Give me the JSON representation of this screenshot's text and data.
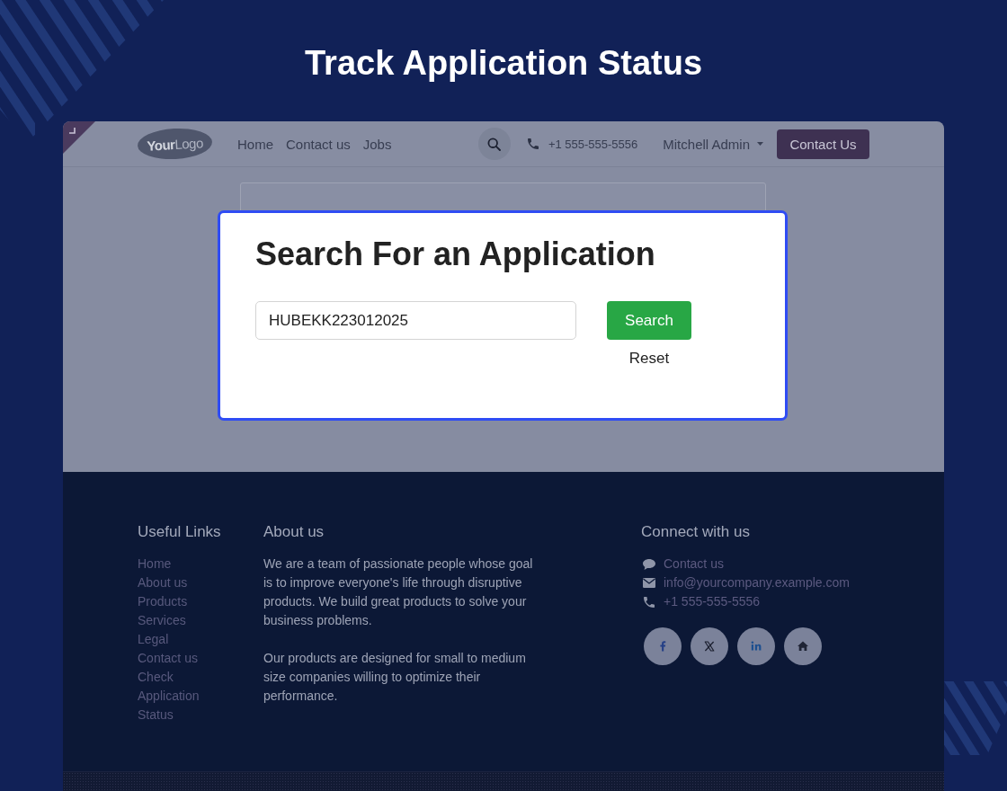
{
  "page_title": "Track Application Status",
  "site": {
    "header": {
      "logo": "**Your**Logo",
      "nav": [
        {
          "label": "Home"
        },
        {
          "label": "Contact us"
        },
        {
          "label": "Jobs"
        }
      ],
      "phone": "+1 555-555-5556",
      "user": "Mitchell Admin",
      "cta": "Contact Us"
    },
    "dialog": {
      "title": "Search For an Application",
      "search_field": {
        "value": "HUBEKK223012025"
      },
      "search_button": "Search",
      "reset": "Reset"
    },
    "footer": {
      "useful_links": {
        "heading": "Useful Links",
        "links": [
          "Home",
          "About us",
          "Products",
          "Services",
          "Legal",
          "Contact us",
          "Check Application Status"
        ]
      },
      "about": {
        "heading": "About us",
        "paragraphs": [
          "We are a team of passionate people whose goal is to improve everyone's life through disruptive products. We build great products to solve your business problems.",
          "Our products are designed for small to medium size companies willing to optimize their performance."
        ]
      },
      "connect": {
        "heading": "Connect with us",
        "items": [
          {
            "kind": "chat",
            "label": "Contact us"
          },
          {
            "kind": "email",
            "label": "info@yourcompany.example.com"
          },
          {
            "kind": "phone",
            "label": "+1 555-555-5556"
          }
        ]
      }
    }
  }
}
